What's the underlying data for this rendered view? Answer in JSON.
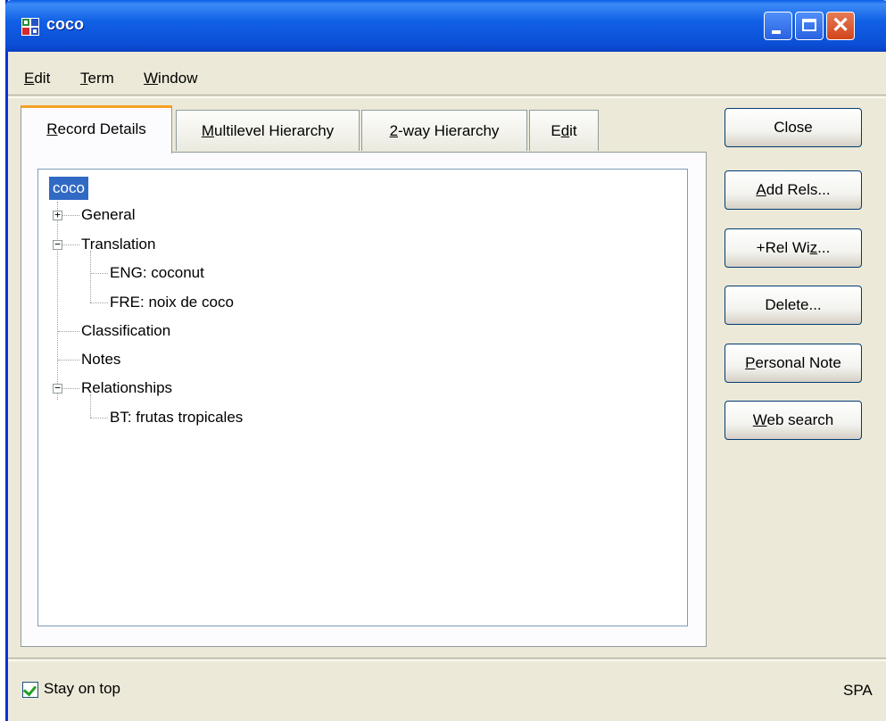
{
  "window": {
    "title": "coco",
    "app_icon": "grid-app-icon"
  },
  "menu": [
    {
      "label": "Edit",
      "mnemonic": "E",
      "rest": "dit"
    },
    {
      "label": "Term",
      "mnemonic": "T",
      "rest": "erm"
    },
    {
      "label": "Window",
      "mnemonic": "W",
      "rest": "indow"
    }
  ],
  "tabs": {
    "record_details": {
      "pre": "",
      "mn": "R",
      "post": "ecord Details",
      "active": true
    },
    "multilevel": {
      "pre": "",
      "mn": "M",
      "post": "ultilevel Hierarchy"
    },
    "two_way": {
      "pre": "",
      "mn": "2",
      "post": "-way Hierarchy"
    },
    "edit": {
      "pre": "E",
      "mn": "d",
      "post": "it"
    }
  },
  "tree": {
    "root": "coco",
    "general": "General",
    "translation": "Translation",
    "translation_children": [
      "ENG: coconut",
      "FRE: noix de coco"
    ],
    "classification": "Classification",
    "notes": "Notes",
    "relationships": "Relationships",
    "relationships_children": [
      "BT: frutas tropicales"
    ]
  },
  "buttons": {
    "close": {
      "pre": "Close",
      "mn": "",
      "post": ""
    },
    "add_rels": {
      "pre": "",
      "mn": "A",
      "post": "dd Rels..."
    },
    "rel_wiz": {
      "pre": "+Rel Wi",
      "mn": "z",
      "post": "..."
    },
    "delete": {
      "pre": "Delete...",
      "mn": "",
      "post": ""
    },
    "personal_note": {
      "pre": "",
      "mn": "P",
      "post": "ersonal Note"
    },
    "web_search": {
      "pre": "",
      "mn": "W",
      "post": "eb search"
    }
  },
  "status": {
    "stay_on_top": "Stay on top",
    "stay_on_top_checked": true,
    "language": "SPA"
  },
  "colors": {
    "title_bar": "#0b4fd6",
    "selection": "#316ac5",
    "tab_accent": "#f5a223",
    "window_bg": "#ece9d8"
  }
}
